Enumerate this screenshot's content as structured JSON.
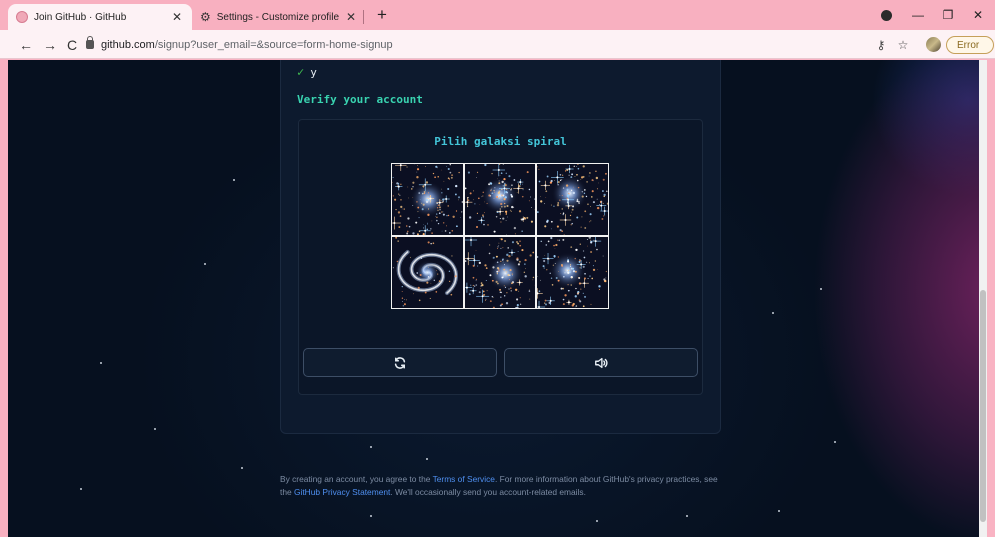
{
  "browser": {
    "tabs": [
      {
        "title": "Join GitHub · GitHub",
        "active": true
      },
      {
        "title": "Settings - Customize profile",
        "active": false
      }
    ],
    "new_tab_label": "+",
    "url_host": "github.com",
    "url_path": "/signup?user_email=&source=form-home-signup",
    "error_label": "Error",
    "colors": {
      "tabbar": "#f8b0c0",
      "toolbar": "#fdf2f5"
    }
  },
  "signup": {
    "previous_answer": "y",
    "verify_title": "Verify your account",
    "captcha": {
      "prompt": "Pilih galaksi spiral",
      "tiles": [
        {
          "kind": "star-cluster"
        },
        {
          "kind": "star-cluster"
        },
        {
          "kind": "star-cluster"
        },
        {
          "kind": "spiral-galaxy"
        },
        {
          "kind": "star-cluster"
        },
        {
          "kind": "star-cluster"
        }
      ],
      "refresh_icon": "refresh-icon",
      "audio_icon": "speaker-icon"
    },
    "colors": {
      "accent": "#39d3b0",
      "prompt": "#43c5d8",
      "check": "#3fb950"
    }
  },
  "footer": {
    "text_1": "By creating an account, you agree to the ",
    "terms_link": "Terms of Service",
    "text_2": ". For more information about GitHub's privacy practices, see the ",
    "privacy_link": "GitHub Privacy Statement",
    "text_3": ". We'll occasionally send you account-related emails."
  }
}
